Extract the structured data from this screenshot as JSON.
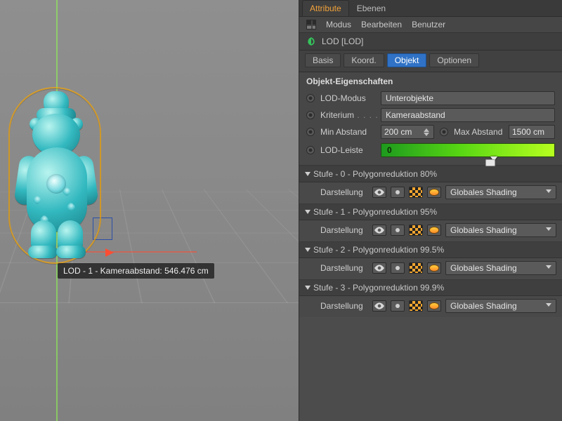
{
  "viewport": {
    "overlay_text": "LOD - 1 - Kameraabstand: 546.476 cm"
  },
  "panel": {
    "top_tabs": {
      "attribute": "Attribute",
      "ebenen": "Ebenen"
    },
    "menus": {
      "modus": "Modus",
      "bearbeiten": "Bearbeiten",
      "benutzer": "Benutzer"
    },
    "object_name": "LOD [LOD]",
    "prop_tabs": {
      "basis": "Basis",
      "koord": "Koord.",
      "objekt": "Objekt",
      "optionen": "Optionen"
    },
    "section_title": "Objekt-Eigenschaften",
    "rows": {
      "lod_modus_label": "LOD-Modus",
      "lod_modus_value": "Unterobjekte",
      "kriterium_label": "Kriterium",
      "kriterium_value": "Kameraabstand",
      "min_label": "Min Abstand",
      "min_value": "200 cm",
      "max_label": "Max Abstand",
      "max_value": "1500 cm",
      "leiste_label": "LOD-Leiste",
      "leiste_value": "0"
    },
    "stages": [
      {
        "title": "Stufe - 0 - Polygonreduktion 80%",
        "darstellung_label": "Darstellung",
        "shading": "Globales Shading"
      },
      {
        "title": "Stufe - 1 - Polygonreduktion 95%",
        "darstellung_label": "Darstellung",
        "shading": "Globales Shading"
      },
      {
        "title": "Stufe - 2 - Polygonreduktion 99.5%",
        "darstellung_label": "Darstellung",
        "shading": "Globales Shading"
      },
      {
        "title": "Stufe - 3 - Polygonreduktion 99.9%",
        "darstellung_label": "Darstellung",
        "shading": "Globales Shading"
      }
    ]
  }
}
